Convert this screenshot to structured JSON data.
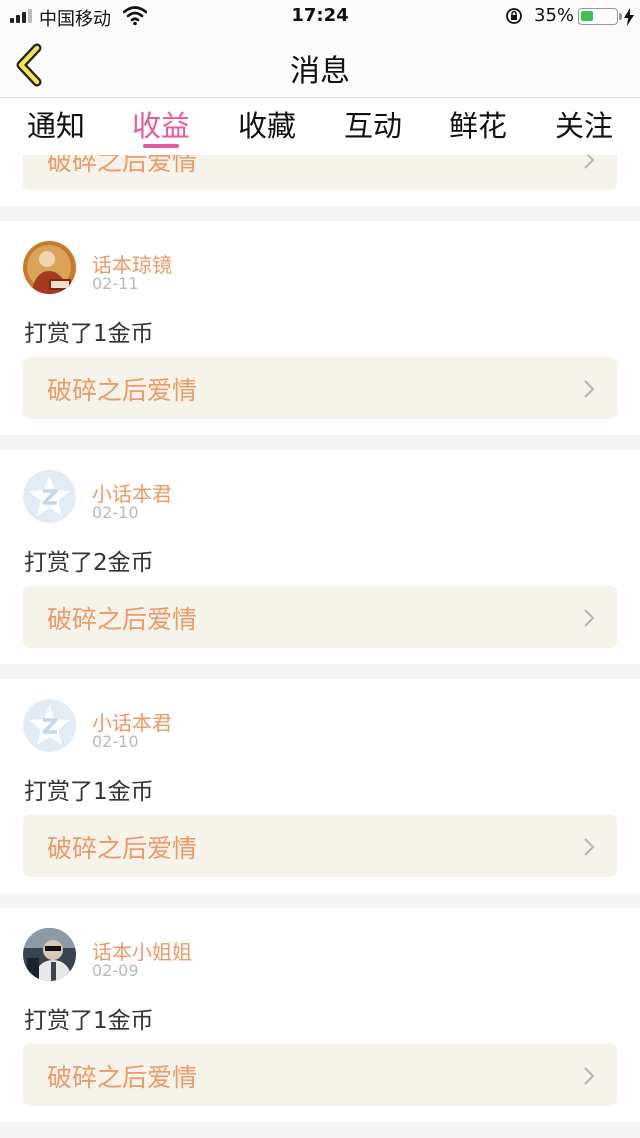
{
  "status_bar": {
    "carrier": "中国移动",
    "time": "17:24",
    "battery": "35%",
    "battery_level": 0.35
  },
  "nav": {
    "title": "消息"
  },
  "tabs": [
    {
      "label": "通知"
    },
    {
      "label": "收益",
      "active": true
    },
    {
      "label": "收藏"
    },
    {
      "label": "互动"
    },
    {
      "label": "鲜花"
    },
    {
      "label": "关注"
    }
  ],
  "feed": {
    "partial_item": {
      "book": "破碎之后爱情"
    },
    "items": [
      {
        "user": "话本琼镜",
        "date": "02-11",
        "message": "打赏了1金币",
        "book": "破碎之后爱情",
        "avatar": "avatar-photo-icon"
      },
      {
        "user": "小话本君",
        "date": "02-10",
        "message": "打赏了2金币",
        "book": "破碎之后爱情",
        "avatar": "default-avatar-icon"
      },
      {
        "user": "小话本君",
        "date": "02-10",
        "message": "打赏了1金币",
        "book": "破碎之后爱情",
        "avatar": "default-avatar-icon"
      },
      {
        "user": "话本小姐姐",
        "date": "02-09",
        "message": "打赏了1金币",
        "book": "破碎之后爱情",
        "avatar": "avatar-photo-icon"
      }
    ]
  },
  "colors": {
    "accent": "#e65a9e",
    "username": "#ec9a67",
    "book_bg": "#f5f3ea"
  }
}
